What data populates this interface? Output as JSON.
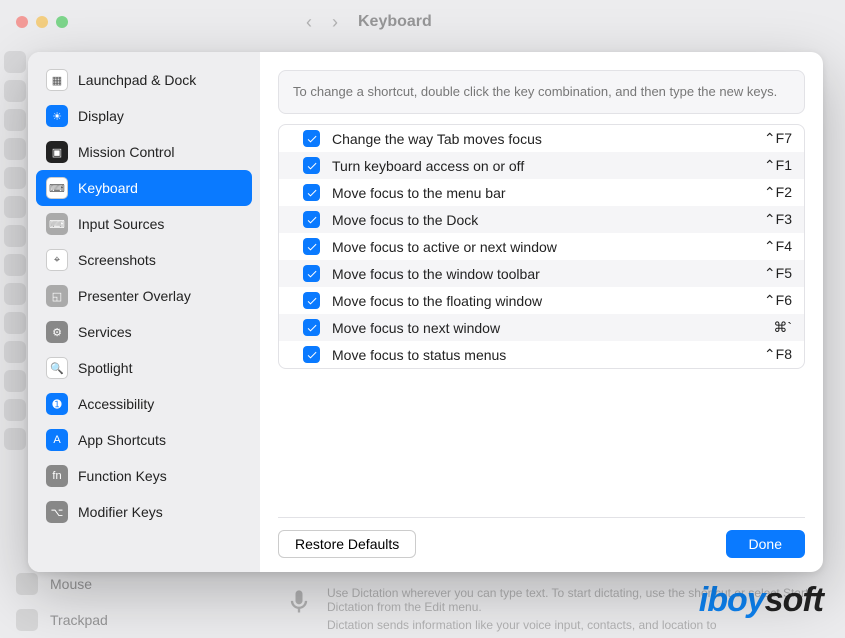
{
  "background": {
    "title": "Keyboard",
    "bottom_items": [
      "Mouse",
      "Trackpad"
    ],
    "dictation_text1": "Use Dictation wherever you can type text. To start dictating, use the shortcut or select Start Dictation from the Edit menu.",
    "dictation_text2": "Dictation sends information like your voice input, contacts, and location to"
  },
  "watermark": {
    "left": "iBoy",
    "right": "soft"
  },
  "sheet": {
    "hint": "To change a shortcut, double click the key combination, and then type the new keys.",
    "restore_label": "Restore Defaults",
    "done_label": "Done",
    "sidebar": [
      {
        "label": "Launchpad & Dock",
        "icon_name": "launchpad-icon",
        "bg": "#ffffff",
        "fg": "#555"
      },
      {
        "label": "Display",
        "icon_name": "display-icon",
        "bg": "#0a7aff",
        "fg": "#fff"
      },
      {
        "label": "Mission Control",
        "icon_name": "mission-control-icon",
        "bg": "#222",
        "fg": "#fff"
      },
      {
        "label": "Keyboard",
        "icon_name": "keyboard-icon",
        "bg": "#ffffff",
        "fg": "#555",
        "selected": true
      },
      {
        "label": "Input Sources",
        "icon_name": "input-sources-icon",
        "bg": "#aaa",
        "fg": "#fff"
      },
      {
        "label": "Screenshots",
        "icon_name": "screenshots-icon",
        "bg": "#ffffff",
        "fg": "#555"
      },
      {
        "label": "Presenter Overlay",
        "icon_name": "presenter-overlay-icon",
        "bg": "#aaa",
        "fg": "#fff"
      },
      {
        "label": "Services",
        "icon_name": "services-icon",
        "bg": "#888",
        "fg": "#fff"
      },
      {
        "label": "Spotlight",
        "icon_name": "spotlight-icon",
        "bg": "#ffffff",
        "fg": "#555"
      },
      {
        "label": "Accessibility",
        "icon_name": "accessibility-icon",
        "bg": "#0a7aff",
        "fg": "#fff"
      },
      {
        "label": "App Shortcuts",
        "icon_name": "app-shortcuts-icon",
        "bg": "#0a7aff",
        "fg": "#fff"
      },
      {
        "label": "Function Keys",
        "icon_name": "function-keys-icon",
        "bg": "#888",
        "fg": "#fff"
      },
      {
        "label": "Modifier Keys",
        "icon_name": "modifier-keys-icon",
        "bg": "#888",
        "fg": "#fff"
      }
    ],
    "shortcuts": [
      {
        "checked": true,
        "label": "Change the way Tab moves focus",
        "key": "⌃F7"
      },
      {
        "checked": true,
        "label": "Turn keyboard access on or off",
        "key": "⌃F1"
      },
      {
        "checked": true,
        "label": "Move focus to the menu bar",
        "key": "⌃F2"
      },
      {
        "checked": true,
        "label": "Move focus to the Dock",
        "key": "⌃F3"
      },
      {
        "checked": true,
        "label": "Move focus to active or next window",
        "key": "⌃F4"
      },
      {
        "checked": true,
        "label": "Move focus to the window toolbar",
        "key": "⌃F5"
      },
      {
        "checked": true,
        "label": "Move focus to the floating window",
        "key": "⌃F6"
      },
      {
        "checked": true,
        "label": "Move focus to next window",
        "key": "⌘`"
      },
      {
        "checked": true,
        "label": "Move focus to status menus",
        "key": "⌃F8"
      }
    ]
  },
  "icons": {
    "launchpad-icon": "▦",
    "display-icon": "☀",
    "mission-control-icon": "▣",
    "keyboard-icon": "⌨",
    "input-sources-icon": "⌨",
    "screenshots-icon": "⌖",
    "presenter-overlay-icon": "◱",
    "services-icon": "⚙",
    "spotlight-icon": "🔍",
    "accessibility-icon": "➊",
    "app-shortcuts-icon": "A",
    "function-keys-icon": "fn",
    "modifier-keys-icon": "⌥"
  }
}
